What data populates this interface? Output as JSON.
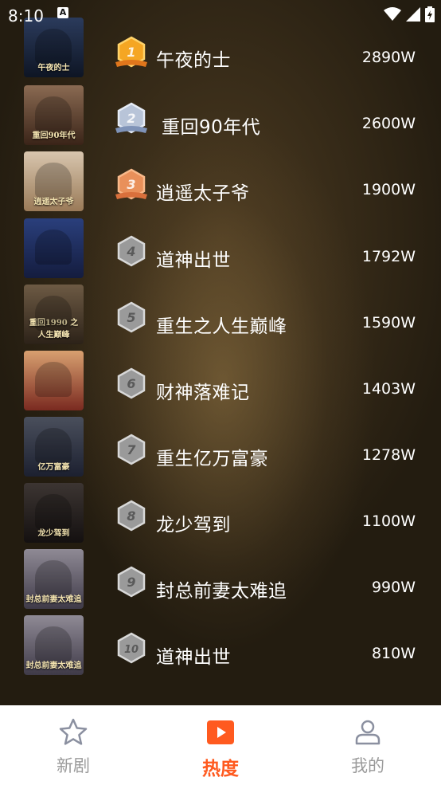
{
  "status_bar": {
    "time": "8:10",
    "notification": "A"
  },
  "ranking": [
    {
      "rank": "1",
      "title": "午夜的士",
      "heat": "2890W",
      "poster_top": "#2b3b5c",
      "poster_bottom": "#0e1524",
      "poster_text": "午夜的士"
    },
    {
      "rank": "2",
      "title": "重回90年代",
      "heat": "2600W",
      "poster_top": "#8a6a52",
      "poster_bottom": "#3a2418",
      "poster_text": "重回90年代"
    },
    {
      "rank": "3",
      "title": "逍遥太子爷",
      "heat": "1900W",
      "poster_top": "#d8c6ae",
      "poster_bottom": "#9a7a58",
      "poster_text": "逍遥太子爷"
    },
    {
      "rank": "4",
      "title": "道神出世",
      "heat": "1792W",
      "poster_top": "#2a3f7c",
      "poster_bottom": "#141c3e",
      "poster_text": ""
    },
    {
      "rank": "5",
      "title": "重生之人生巅峰",
      "heat": "1590W",
      "poster_top": "#6d5a44",
      "poster_bottom": "#2c2218",
      "poster_text": "重回1990 之人生巅峰"
    },
    {
      "rank": "6",
      "title": "财神落难记",
      "heat": "1403W",
      "poster_top": "#d8a070",
      "poster_bottom": "#7a2a20",
      "poster_text": ""
    },
    {
      "rank": "7",
      "title": "重生亿万富豪",
      "heat": "1278W",
      "poster_top": "#4a4f5c",
      "poster_bottom": "#1c2030",
      "poster_text": "亿万富豪"
    },
    {
      "rank": "8",
      "title": "龙少驾到",
      "heat": "1100W",
      "poster_top": "#3c3532",
      "poster_bottom": "#141010",
      "poster_text": "龙少驾到"
    },
    {
      "rank": "9",
      "title": "封总前妻太难追",
      "heat": "990W",
      "poster_top": "#8f8a95",
      "poster_bottom": "#3f3a48",
      "poster_text": "封总前妻太难追"
    },
    {
      "rank": "10",
      "title": "道神出世",
      "heat": "810W",
      "poster_top": "#8f8a95",
      "poster_bottom": "#3f3a48",
      "poster_text": "封总前妻太难追"
    }
  ],
  "tabs": [
    {
      "label": "新剧",
      "icon": "star-icon",
      "active": false
    },
    {
      "label": "热度",
      "icon": "play-icon",
      "active": true
    },
    {
      "label": "我的",
      "icon": "user-icon",
      "active": false
    }
  ],
  "colors": {
    "accent": "#ff5a1f",
    "gold": "#f5a623",
    "silver": "#b8c4d8",
    "bronze": "#e9905a",
    "gray_badge": "#8a8a8a"
  }
}
